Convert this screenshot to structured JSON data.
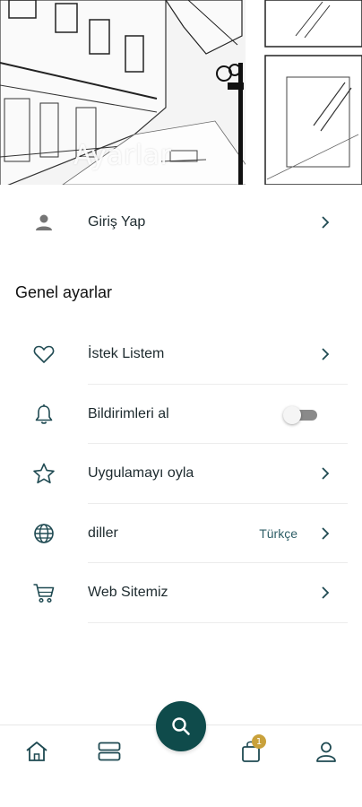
{
  "header": {
    "title": "Ayarlar"
  },
  "account": {
    "login_label": "Giriş Yap"
  },
  "general": {
    "title": "Genel ayarlar",
    "items": [
      {
        "label": "İstek Listem",
        "icon": "heart-icon"
      },
      {
        "label": "Bildirimleri al",
        "icon": "bell-icon",
        "toggle": false
      },
      {
        "label": "Uygulamayı oyla",
        "icon": "star-icon"
      },
      {
        "label": "diller",
        "icon": "globe-icon",
        "value": "Türkçe"
      },
      {
        "label": "Web Sitemiz",
        "icon": "cart-icon"
      }
    ]
  },
  "bottom_nav": {
    "items": [
      "home-icon",
      "categories-icon",
      "search-icon",
      "bag-icon",
      "profile-icon"
    ],
    "cart_badge": "1"
  },
  "colors": {
    "accent": "#0f4b4b",
    "icon": "#1f4a52",
    "badge": "#c9a13b"
  }
}
